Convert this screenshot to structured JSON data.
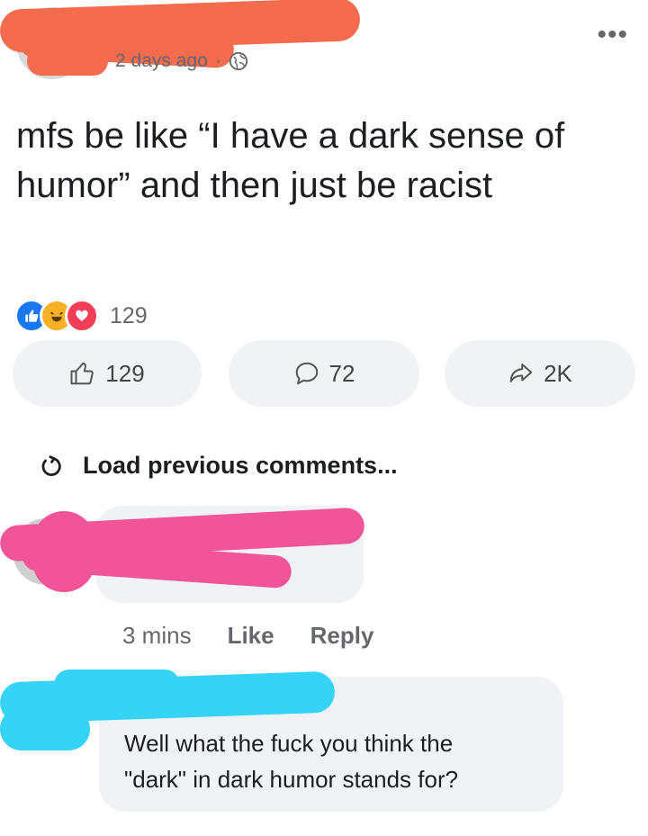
{
  "post": {
    "meta_time": "2 days ago",
    "meta_separator": "·",
    "privacy_icon": "globe-icon",
    "more_icon": "more-options-icon",
    "more_label": "•••",
    "text": "mfs be like “I have a dark sense of humor” and then just be racist",
    "reaction_count": "129",
    "reaction_icons": [
      "like-reaction-icon",
      "haha-reaction-icon",
      "love-reaction-icon"
    ],
    "like_count": "129",
    "comment_count": "72",
    "share_count": "2K"
  },
  "load_previous": {
    "label": "Load previous comments...",
    "icon": "refresh-icon"
  },
  "comments": [
    {
      "author_redacted": true,
      "time": "3 mins",
      "like_label": "Like",
      "reply_label": "Reply"
    },
    {
      "author_redacted": true,
      "text_line1": "Well what the fuck you think the",
      "text_line2": "\"dark\" in dark humor stands for?"
    }
  ],
  "colors": {
    "redact_orange": "#f56b4e",
    "redact_pink": "#f2549a",
    "redact_cyan": "#35d3f5",
    "like_blue": "#1877f2",
    "text_gray": "#65676b",
    "pill_bg": "#f0f2f5"
  }
}
